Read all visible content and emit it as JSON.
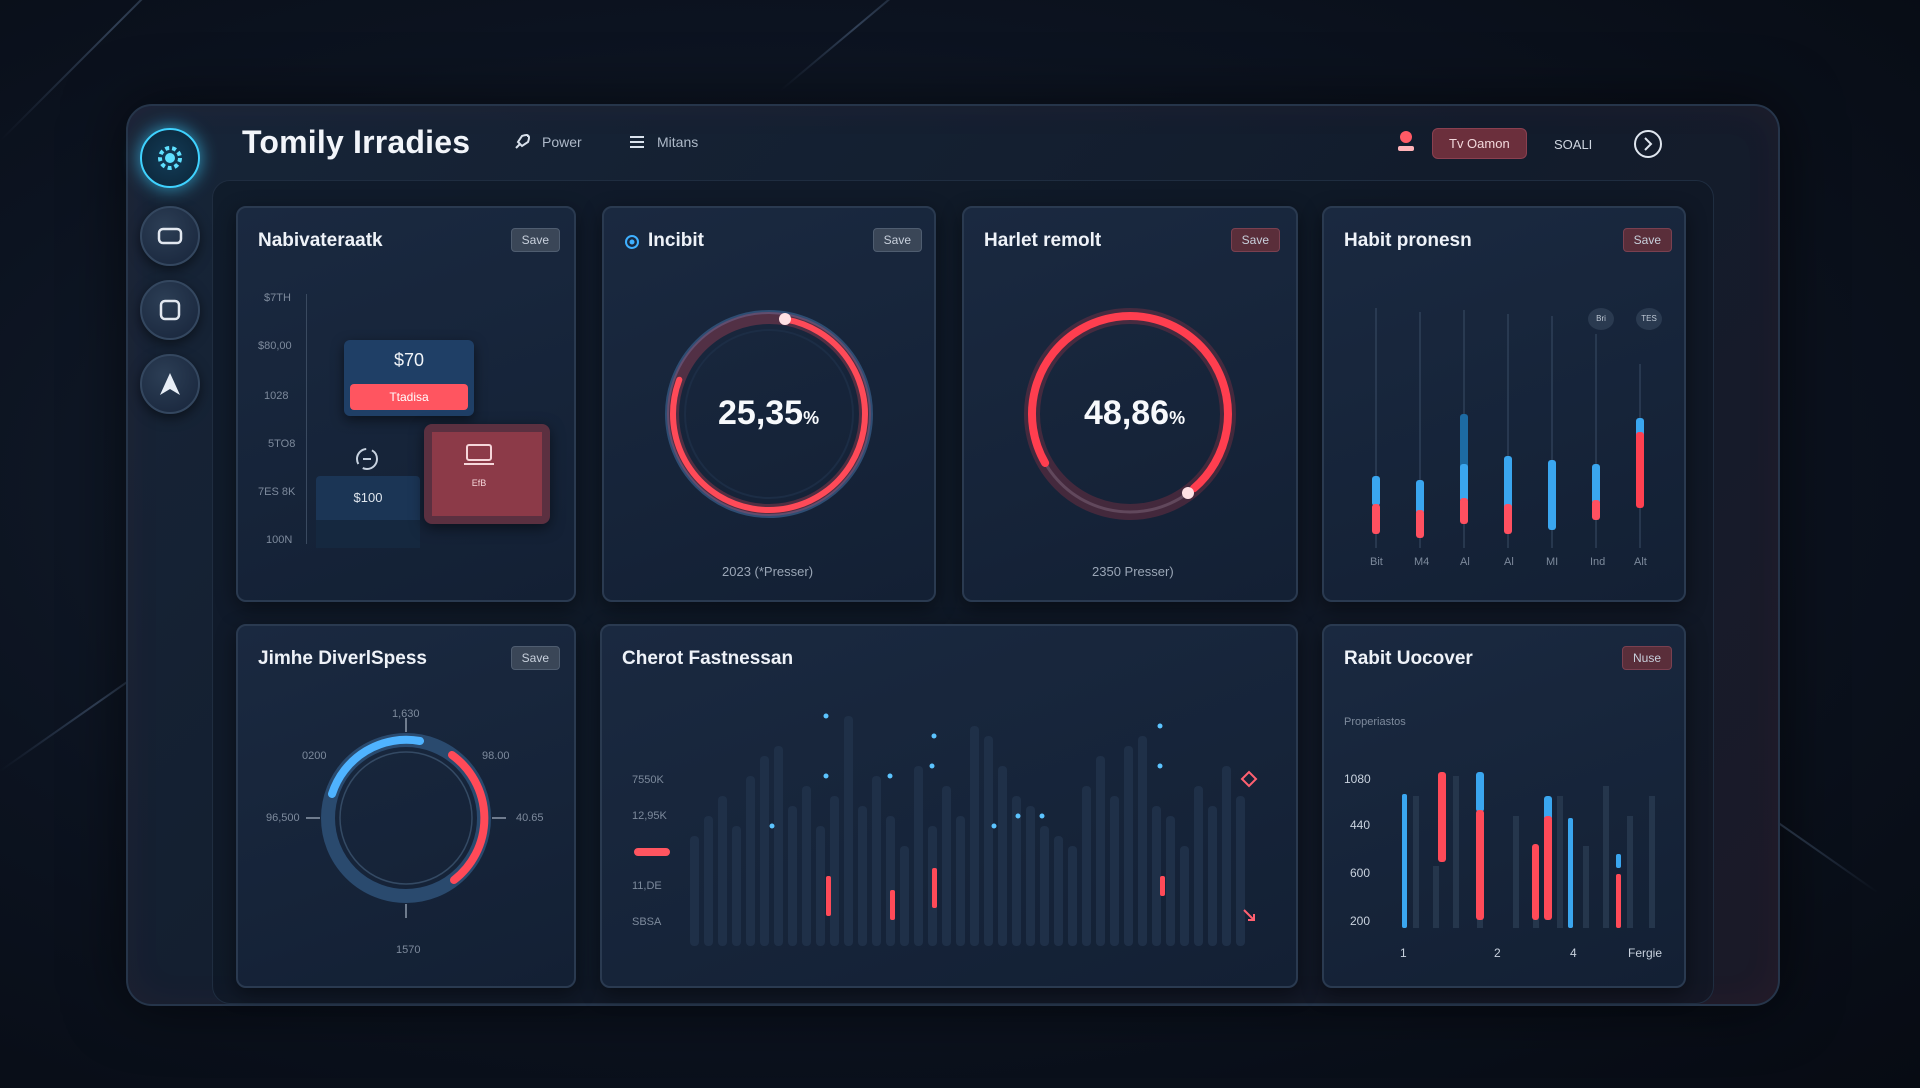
{
  "header": {
    "title": "Tomily Irradies",
    "nav": [
      {
        "label": "Power",
        "icon": "rocket-icon"
      },
      {
        "label": "Mitans",
        "icon": "menu-icon"
      }
    ],
    "user_button": "Tv Oamon",
    "status_text": "SOALI"
  },
  "sidebar": {
    "items": [
      {
        "name": "settings",
        "icon": "gear-icon"
      },
      {
        "name": "display",
        "icon": "monitor-icon"
      },
      {
        "name": "window",
        "icon": "square-icon"
      },
      {
        "name": "navigate",
        "icon": "arrow-up-icon"
      }
    ]
  },
  "cards": {
    "nav": {
      "title": "Nabivateraatk",
      "button": "Save",
      "y_labels": [
        "$7TH",
        "$80,00",
        "1028",
        "5TO8",
        "7ES 8K",
        "100N"
      ],
      "price_top": "$70",
      "price_top_button": "Ttadisa",
      "price_bottom": "$100",
      "tile_caption": "EfB"
    },
    "incibit": {
      "title": "Incibit",
      "button": "Save",
      "value": "25,35",
      "unit": "%",
      "progress": 0.78,
      "caption": "2023 (*Presser)"
    },
    "harlet": {
      "title": "Harlet remolt",
      "button": "Save",
      "value": "48,86",
      "unit": "%",
      "progress": 0.72,
      "caption": "2350 Presser)"
    },
    "habit": {
      "title": "Habit pronesn",
      "button": "Save",
      "legend_chips": [
        "Bri",
        "TES"
      ],
      "x_labels": [
        "Bit",
        "M4",
        "Al",
        "Al",
        "MI",
        "Ind",
        "Alt"
      ]
    },
    "jimhe": {
      "title": "Jimhe DiverlSpess",
      "button": "Save",
      "ticks": {
        "top": "1,630",
        "top_left": "0200",
        "top_right": "98.00",
        "left": "96,500",
        "right": "40.65",
        "bottom": "1570"
      }
    },
    "cherot": {
      "title": "Cherot Fastnessan",
      "y_labels": [
        "7550K",
        "12,95K",
        "11,DE",
        "SBSA"
      ]
    },
    "rabit": {
      "title": "Rabit Uocover",
      "button": "Nuse",
      "subtitle": "Properiastos",
      "y_labels": [
        "1080",
        "440",
        "600",
        "200"
      ],
      "x_labels": [
        "1",
        "2",
        "4",
        "Fergie"
      ]
    }
  },
  "colors": {
    "accent_blue": "#3fa9f5",
    "accent_red": "#ff4a55",
    "card_bg": "#16243a"
  }
}
